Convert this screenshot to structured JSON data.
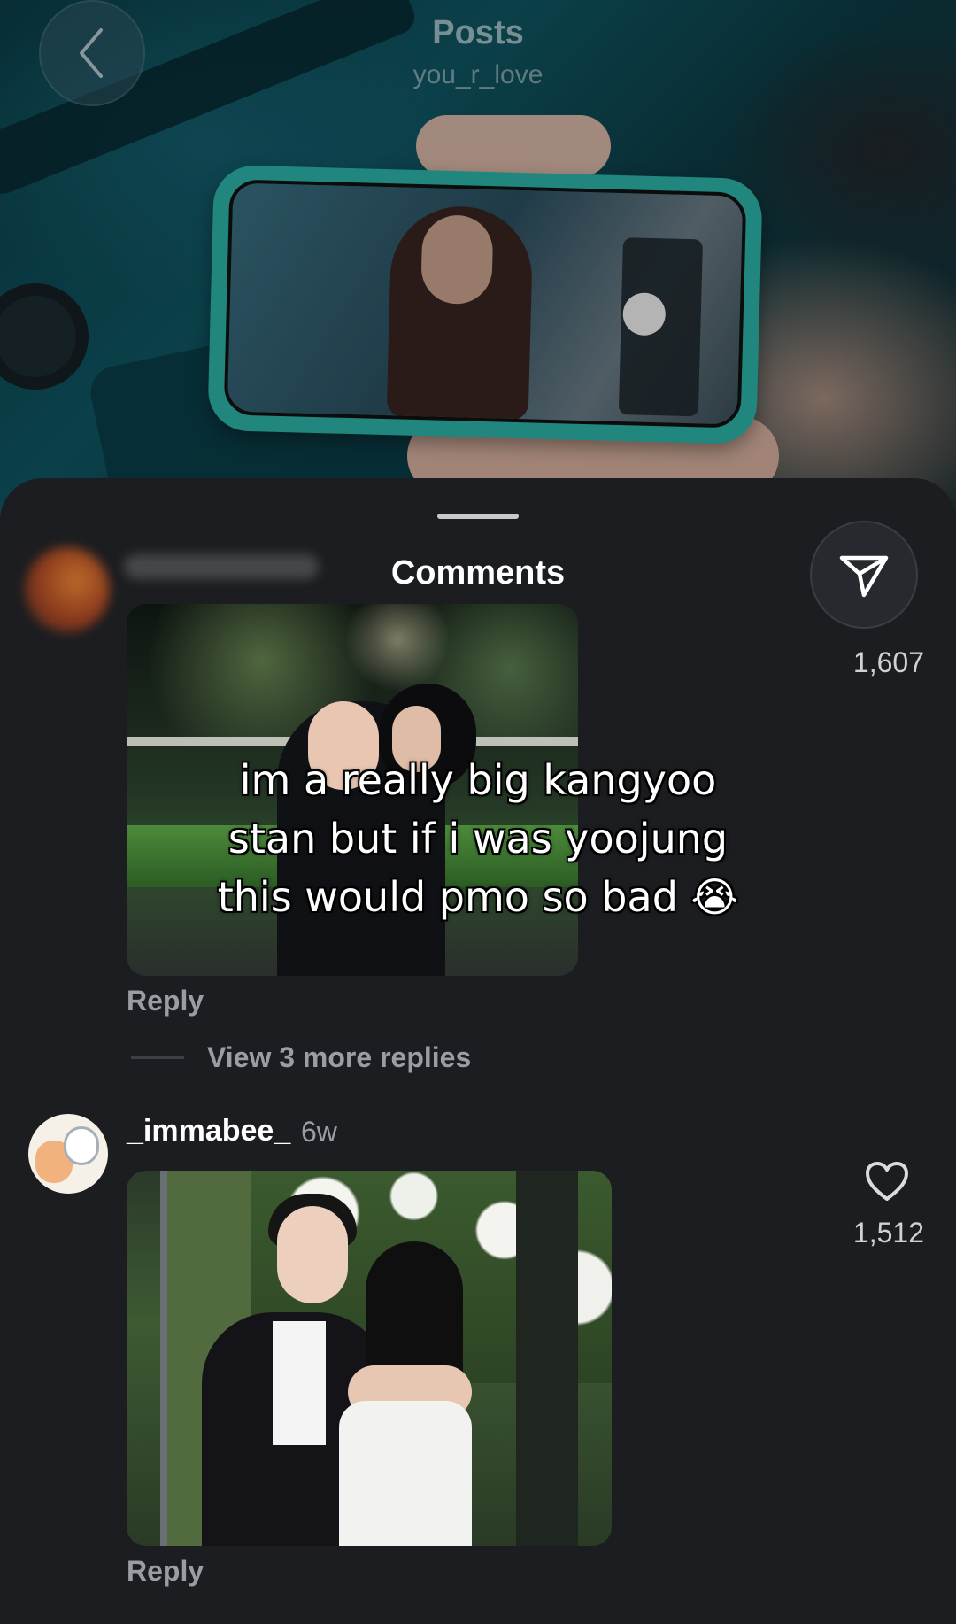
{
  "header": {
    "title": "Posts",
    "subtitle": "you_r_love"
  },
  "sheet": {
    "title": "Comments"
  },
  "comments": [
    {
      "caption_lines": [
        "im a really big kangyoo",
        "stan but if i was yoojung",
        "this would pmo so bad 😭"
      ],
      "reply_label": "Reply",
      "view_more_label": "View 3 more replies",
      "count": "1,607"
    },
    {
      "username": "_immabee_",
      "time": "6w",
      "reply_label": "Reply",
      "like_count": "1,512"
    }
  ],
  "icons": {
    "back": "chevron-left-icon",
    "share": "send-icon",
    "like": "heart-icon"
  },
  "colors": {
    "sheet_bg": "#1b1d20",
    "secondary_text": "#9a9da3"
  }
}
